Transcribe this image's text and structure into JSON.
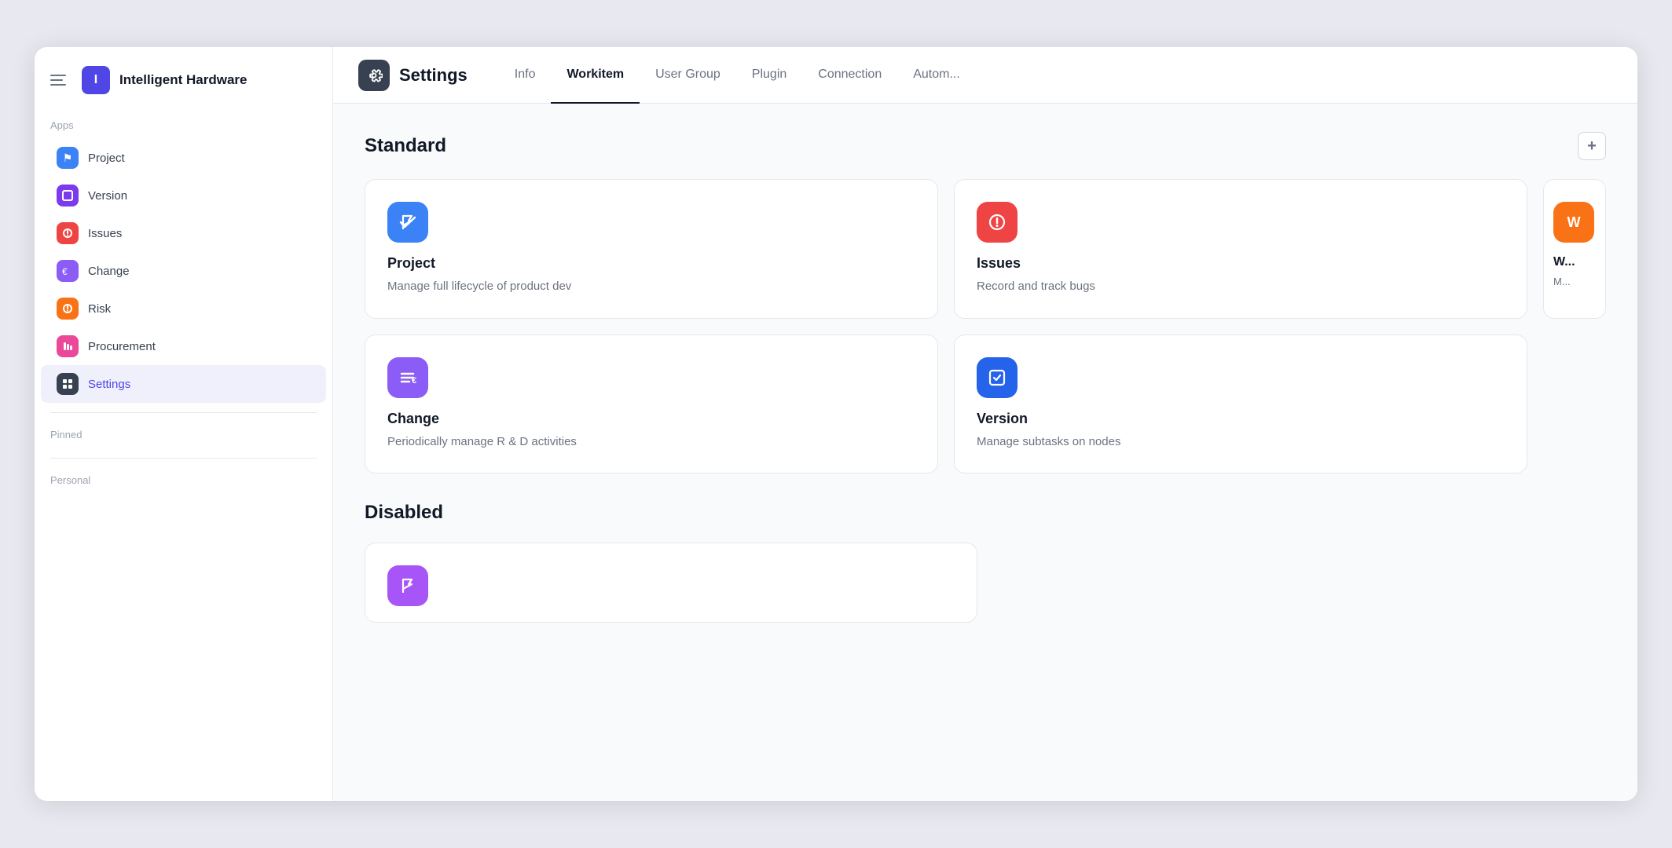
{
  "sidebar": {
    "workspace": {
      "logo_letter": "I",
      "name": "Intelligent Hardware"
    },
    "sections": {
      "apps_label": "Apps",
      "pinned_label": "Pinned",
      "personal_label": "Personal"
    },
    "nav_items": [
      {
        "id": "project",
        "label": "Project",
        "icon_color": "icon-blue",
        "icon": "⚑",
        "active": false
      },
      {
        "id": "version",
        "label": "Version",
        "icon_color": "icon-violet",
        "icon": "◻",
        "active": false
      },
      {
        "id": "issues",
        "label": "Issues",
        "icon_color": "icon-red",
        "icon": "⊙",
        "active": false
      },
      {
        "id": "change",
        "label": "Change",
        "icon_color": "icon-purple",
        "icon": "≡",
        "active": false
      },
      {
        "id": "risk",
        "label": "Risk",
        "icon_color": "icon-orange-red",
        "icon": "⊙",
        "active": false
      },
      {
        "id": "procurement",
        "label": "Procurement",
        "icon_color": "icon-pink",
        "icon": "♪",
        "active": false
      },
      {
        "id": "settings",
        "label": "Settings",
        "icon_color": "icon-dark",
        "icon": "⊞",
        "active": true
      }
    ]
  },
  "header": {
    "settings_title": "Settings",
    "nav_tabs": [
      {
        "id": "info",
        "label": "Info",
        "active": false
      },
      {
        "id": "workitem",
        "label": "Workitem",
        "active": true
      },
      {
        "id": "user-group",
        "label": "User Group",
        "active": false
      },
      {
        "id": "plugin",
        "label": "Plugin",
        "active": false
      },
      {
        "id": "connection",
        "label": "Connection",
        "active": false
      },
      {
        "id": "automation",
        "label": "Autom...",
        "active": false
      }
    ]
  },
  "content": {
    "standard_section_label": "Standard",
    "disabled_section_label": "Disabled",
    "add_button_label": "+",
    "cards": [
      {
        "id": "project",
        "title": "Project",
        "description": "Manage full lifecycle of product dev",
        "icon": "⚑",
        "icon_color": "card-icon-blue"
      },
      {
        "id": "issues",
        "title": "Issues",
        "description": "Record and track bugs",
        "icon": "⊙",
        "icon_color": "card-icon-red"
      },
      {
        "id": "change",
        "title": "Change",
        "description": "Periodically manage R & D activities",
        "icon": "≡",
        "icon_color": "card-icon-purple"
      },
      {
        "id": "version",
        "title": "Version",
        "description": "Manage subtasks on nodes",
        "icon": "◻",
        "icon_color": "card-icon-blue2"
      }
    ],
    "partial_card": {
      "icon": "W",
      "description": "M...",
      "icon_color": "#f97316"
    },
    "disabled_partial_icon_color": "#a855f7"
  }
}
